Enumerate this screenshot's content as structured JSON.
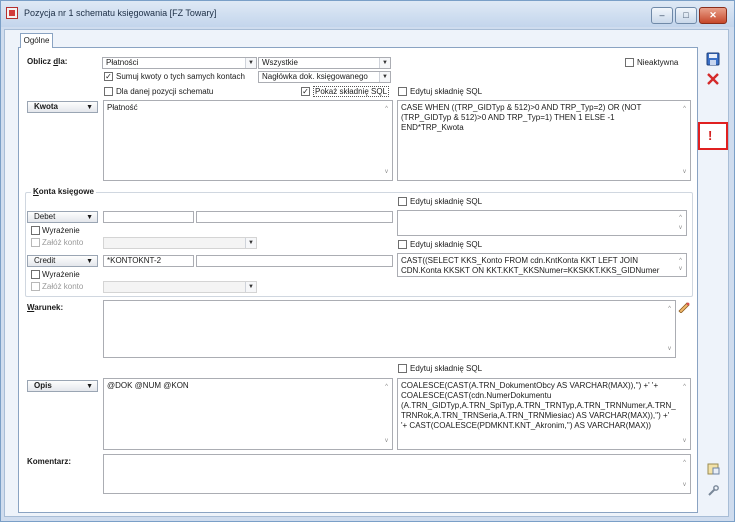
{
  "window": {
    "title": "Pozycja nr 1 schematu księgowania [FZ Towary]",
    "min": "–",
    "max": "□",
    "close": "✕"
  },
  "tab": {
    "label": "Ogólne"
  },
  "oblicz": {
    "label_prefix": "Oblicz ",
    "label_ul": "d",
    "label_suffix": "la:",
    "combo1": "Płatności",
    "combo2": "Wszystkie",
    "combo3": "Nagłówka dok. księgowanego",
    "sumuj": {
      "label": "Sumuj kwoty o tych samych kontach",
      "checked": true
    },
    "dla_danej": {
      "label": "Dla danej pozycji schematu",
      "checked": false
    },
    "pokaz": {
      "label": "Pokaż składnię SQL",
      "checked": true
    },
    "edytuj": {
      "label": "Edytuj składnię SQL",
      "checked": false
    },
    "nieaktywna": {
      "label": "Nieaktywna",
      "checked": false
    }
  },
  "kwota": {
    "button": "Kwota",
    "text": "Płatność",
    "sql": "CASE WHEN ((TRP_GIDTyp & 512)>0 AND TRP_Typ=2) OR (NOT (TRP_GIDTyp & 512)>0 AND TRP_Typ=1) THEN 1 ELSE -1 END*TRP_Kwota"
  },
  "konta": {
    "title_ul": "K",
    "title_rest": "onta księgowe",
    "edytuj1": "Edytuj składnię SQL",
    "edytuj2": "Edytuj składnię SQL",
    "debet": {
      "button": "Debet",
      "wyrazenie": "Wyrażenie",
      "zaloz": "Załóż konto",
      "value": ""
    },
    "credit": {
      "button": "Credit",
      "wyrazenie": "Wyrażenie",
      "zaloz": "Załóż konto",
      "value": "*KONTOKNT-2",
      "sql": "CAST((SELECT KKS_Konto FROM cdn.KntKonta KKT LEFT JOIN CDN.Konta KKSKT ON KKT.KKT_KKSNumer=KKSKKT.KKS_GIDNumer WHERE KKT.KKT_ObiTyp=TRP_KntTyp AND KKT.KKT_KntNumer"
    }
  },
  "warunek": {
    "label_ul": "W",
    "label_rest": "arunek:",
    "edytuj": "Edytuj składnię SQL"
  },
  "opis": {
    "button": "Opis",
    "text": "@DOK @NUM @KON",
    "sql": "COALESCE(CAST(A.TRN_DokumentObcy AS VARCHAR(MAX)),'') +' '+ COALESCE(CAST(cdn.NumerDokumentu (A.TRN_GIDTyp,A.TRN_SpiTyp,A.TRN_TRNTyp,A.TRN_TRNNumer,A.TRN_TRNRok,A.TRN_TRNSeria,A.TRN_TRNMiesiac) AS VARCHAR(MAX)),'') +' '+ CAST(COALESCE(PDMKNT.KNT_Akronim,'') AS VARCHAR(MAX))"
  },
  "komentarz": {
    "label": "Komentarz:"
  },
  "toolbar": {
    "save_icon": "floppy-disk",
    "delete_icon": "red-x",
    "alert_icon": "exclamation",
    "alert_glyph": "!",
    "highlight_color": "#e02020"
  }
}
